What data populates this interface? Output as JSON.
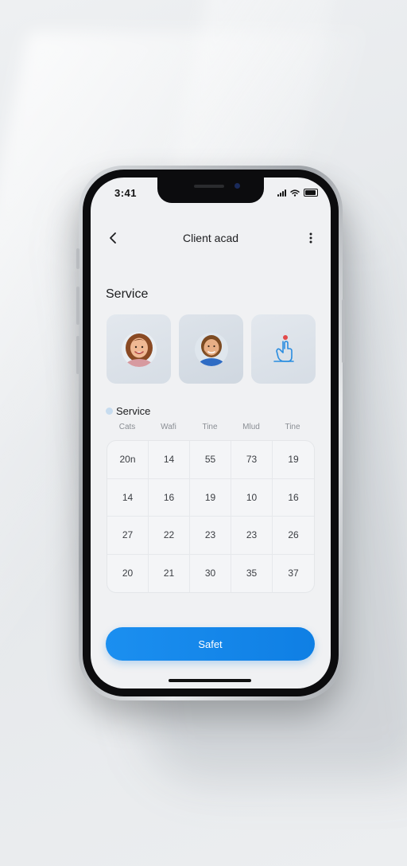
{
  "status_bar": {
    "time": "3:41"
  },
  "nav": {
    "title": "Client acad"
  },
  "section": {
    "title": "Service"
  },
  "cards": [
    {
      "name": "woman-avatar"
    },
    {
      "name": "man-avatar"
    },
    {
      "name": "touch-gesture-icon"
    }
  ],
  "legend": {
    "label": "Service",
    "color": "#c7dcef"
  },
  "table": {
    "headers": [
      "Cats",
      "Wafi",
      "Tine",
      "Mlud",
      "Tine"
    ],
    "rows": [
      [
        "20n",
        "14",
        "55",
        "73",
        "19"
      ],
      [
        "14",
        "16",
        "19",
        "10",
        "16"
      ],
      [
        "27",
        "22",
        "23",
        "23",
        "26"
      ],
      [
        "20",
        "21",
        "30",
        "35",
        "37"
      ]
    ]
  },
  "primary_button": {
    "label": "Safet",
    "color": "#1b8ff0"
  }
}
